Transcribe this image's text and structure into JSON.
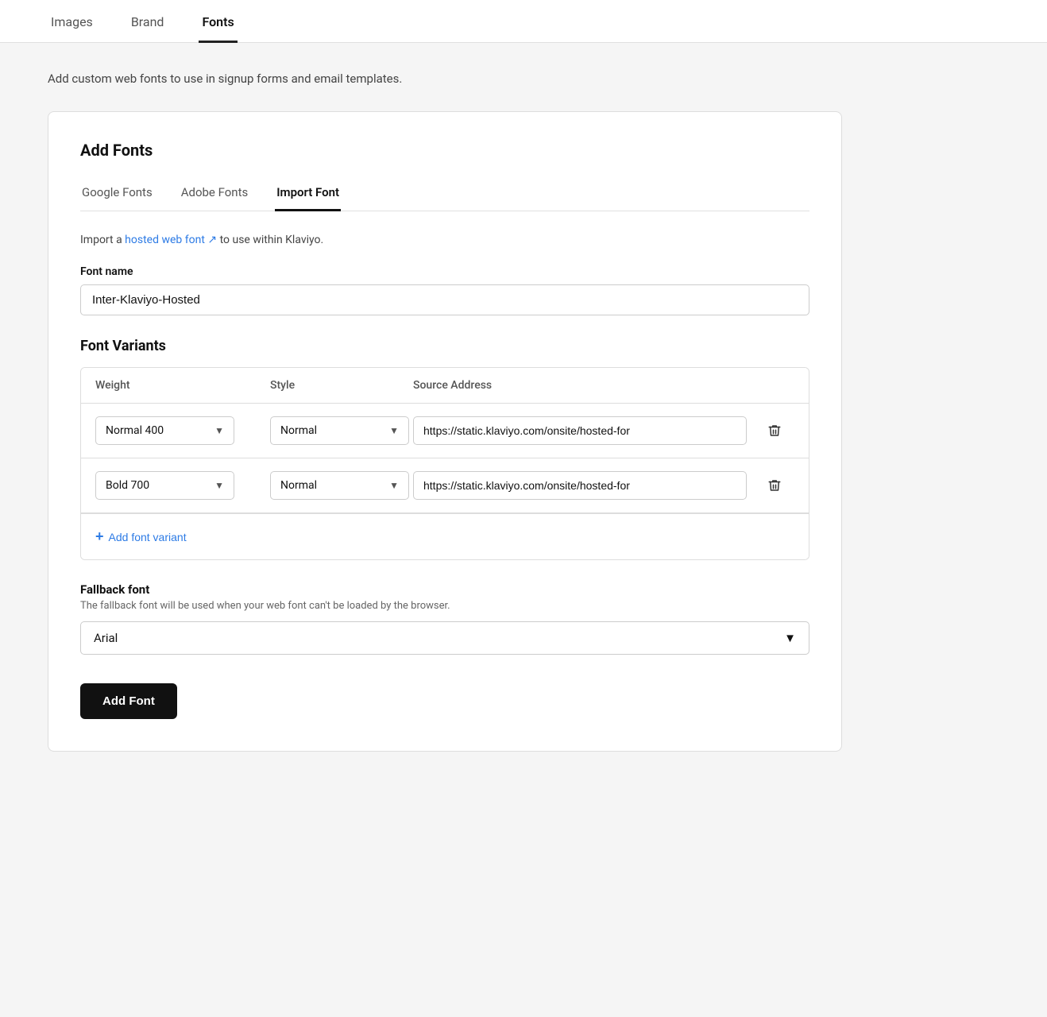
{
  "topTabs": [
    {
      "label": "Images",
      "active": false
    },
    {
      "label": "Brand",
      "active": false
    },
    {
      "label": "Fonts",
      "active": true
    }
  ],
  "pageDescription": "Add custom web fonts to use in signup forms and email templates.",
  "card": {
    "title": "Add Fonts",
    "subTabs": [
      {
        "label": "Google Fonts",
        "active": false
      },
      {
        "label": "Adobe Fonts",
        "active": false
      },
      {
        "label": "Import Font",
        "active": true
      }
    ],
    "importDesc1": "Import a ",
    "importDescLink": "hosted web font",
    "importDesc2": " to use within Klaviyo.",
    "fontNameLabel": "Font name",
    "fontNameValue": "Inter-Klaviyo-Hosted",
    "fontNamePlaceholder": "Font name",
    "fontVariantsTitle": "Font Variants",
    "variantsTableHeaders": {
      "weight": "Weight",
      "style": "Style",
      "sourceAddress": "Source Address"
    },
    "variants": [
      {
        "weight": "Normal 400",
        "style": "Normal",
        "sourceAddress": "https://static.klaviyo.com/onsite/hosted-for"
      },
      {
        "weight": "Bold 700",
        "style": "Normal",
        "sourceAddress": "https://static.klaviyo.com/onsite/hosted-for"
      }
    ],
    "addVariantLabel": "Add font variant",
    "fallbackTitle": "Fallback font",
    "fallbackDesc": "The fallback font will be used when your web font can't be loaded by the browser.",
    "fallbackValue": "Arial",
    "addFontLabel": "Add Font"
  }
}
